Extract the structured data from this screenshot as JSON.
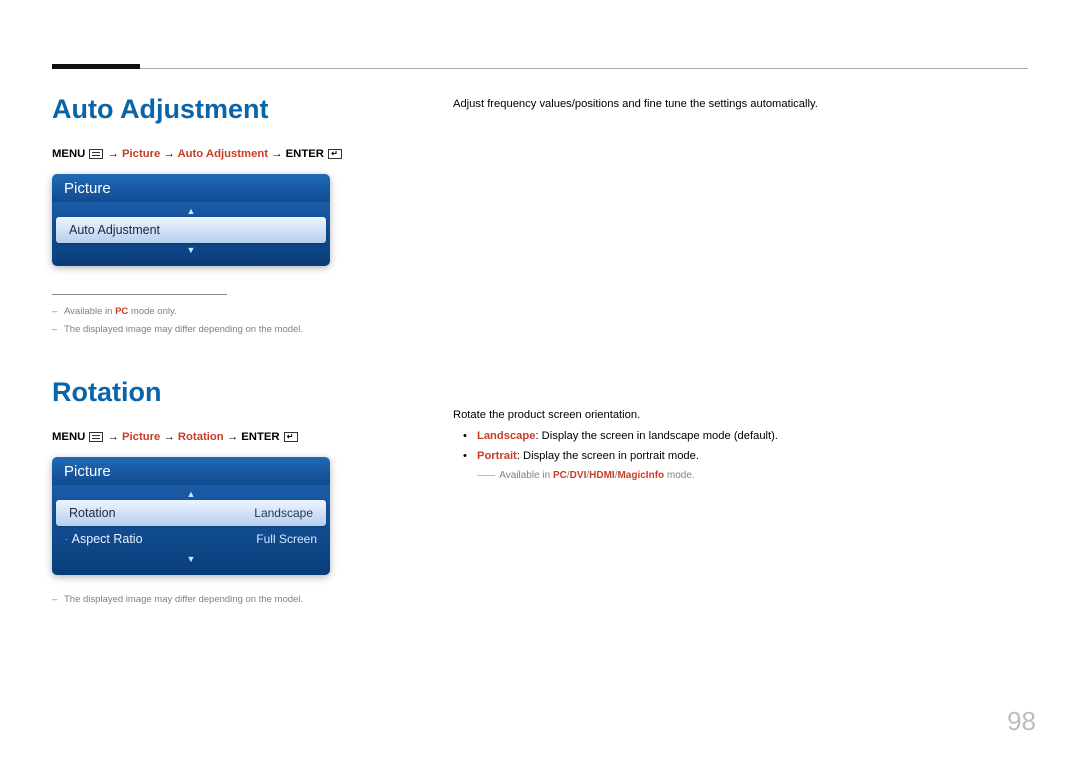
{
  "section1": {
    "title": "Auto Adjustment",
    "breadcrumb": {
      "menu": "MENU",
      "p1": "Picture",
      "p2": "Auto Adjustment",
      "enter": "ENTER"
    },
    "panel": {
      "header": "Picture",
      "row1": "Auto Adjustment"
    },
    "notes": {
      "n1_pre": "Available in ",
      "n1_hl": "PC",
      "n1_post": " mode only.",
      "n2": "The displayed image may differ depending on the model."
    },
    "desc": "Adjust frequency values/positions and fine tune the settings automatically."
  },
  "section2": {
    "title": "Rotation",
    "breadcrumb": {
      "menu": "MENU",
      "p1": "Picture",
      "p2": "Rotation",
      "enter": "ENTER"
    },
    "panel": {
      "header": "Picture",
      "row1_label": "Rotation",
      "row1_value": "Landscape",
      "row2_label": "Aspect Ratio",
      "row2_value": "Full Screen"
    },
    "note": "The displayed image may differ depending on the model.",
    "desc": {
      "intro": "Rotate the product screen orientation.",
      "b1_hl": "Landscape",
      "b1_rest": ": Display the screen in landscape mode (default).",
      "b2_hl": "Portrait",
      "b2_rest": ": Display the screen in portrait mode.",
      "avail_pre": "Available in ",
      "avail_hl1": "PC",
      "avail_sep": "/",
      "avail_hl2": "DVI",
      "avail_hl3": "HDMI",
      "avail_hl4": "MagicInfo",
      "avail_post": " mode."
    }
  },
  "page_number": "98"
}
